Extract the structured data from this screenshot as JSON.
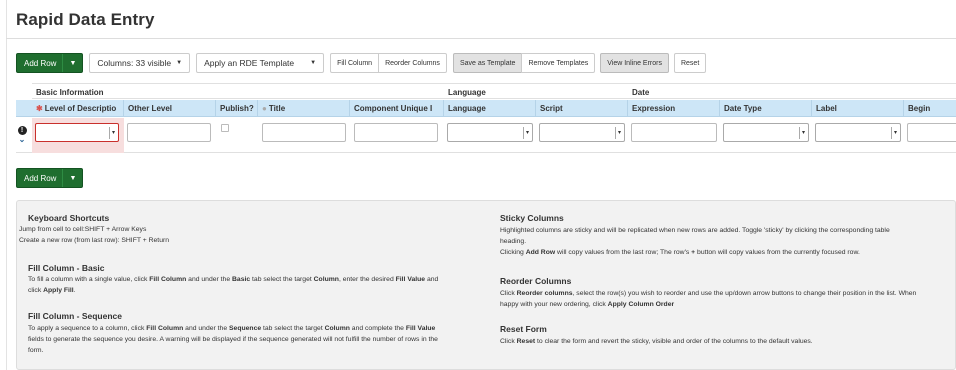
{
  "page": {
    "title": "Rapid Data Entry"
  },
  "toolbar": {
    "add_row": "Add Row",
    "columns_visible": "Columns: 33 visible",
    "template_select": "Apply an RDE Template",
    "fill_column": "Fill Column",
    "reorder_columns": "Reorder Columns",
    "save_as_template": "Save as Template",
    "remove_templates": "Remove Templates",
    "view_inline_errors": "View Inline Errors",
    "reset": "Reset"
  },
  "grid": {
    "groups": [
      "Basic Information",
      "Language",
      "Date"
    ],
    "columns": [
      "Level of Descriptio",
      "Other Level",
      "Publish?",
      "Title",
      "Component Unique I",
      "Language",
      "Script",
      "Expression",
      "Date Type",
      "Label",
      "Begin"
    ]
  },
  "help": {
    "keyboard": {
      "heading": "Keyboard Shortcuts",
      "line1": "Jump from cell to cell:SHIFT + Arrow Keys",
      "line2": "Create a new row (from last row): SHIFT + Return"
    },
    "fill_basic": {
      "heading": "Fill Column - Basic",
      "p1_a": "To fill a column with a single value, click ",
      "p1_b": "Fill Column",
      "p1_c": " and under the ",
      "p1_d": "Basic",
      "p1_e": " tab select the target ",
      "p1_f": "Column",
      "p1_g": ", enter the desired ",
      "p1_h": "Fill Value",
      "p1_i": " and",
      "p2_a": "click ",
      "p2_b": "Apply Fill",
      "p2_c": "."
    },
    "fill_seq": {
      "heading": "Fill Column - Sequence",
      "p1_a": "To apply a sequence to a column, click ",
      "p1_b": "Fill Column",
      "p1_c": " and under the ",
      "p1_d": "Sequence",
      "p1_e": " tab select the target ",
      "p1_f": "Column",
      "p1_g": " and complete the ",
      "p1_h": "Fill Value",
      "p2": "fields to generate the sequence you desire. A warning will be displayed if the sequence generated will not fulfill the number of rows in the",
      "p3": "form."
    },
    "sticky": {
      "heading": "Sticky Columns",
      "p1": "Highlighted columns are sticky and will be replicated when new rows are added. Toggle 'sticky' by clicking the corresponding table",
      "p2": "heading.",
      "p3_a": "Clicking ",
      "p3_b": "Add Row",
      "p3_c": " will copy values from the last row; The row's ",
      "p3_d": "+",
      "p3_e": " button will copy values from the currently focused row."
    },
    "reorder": {
      "heading": "Reorder Columns",
      "p1_a": "Click ",
      "p1_b": "Reorder columns",
      "p1_c": ", select the row(s) you wish to reorder and use the up/down arrow buttons to change their position in the list. When",
      "p2_a": "happy with your new ordering, click ",
      "p2_b": "Apply Column Order"
    },
    "reset": {
      "heading": "Reset Form",
      "p1_a": "Click ",
      "p1_b": "Reset",
      "p1_c": " to clear the form and revert the sticky, visible and order of the columns to the default values."
    }
  },
  "colors": {
    "primary_green": "#1f6e2f",
    "header_blue": "#cde6f7",
    "error_red": "#c9302c",
    "error_bg": "#f7dede"
  }
}
